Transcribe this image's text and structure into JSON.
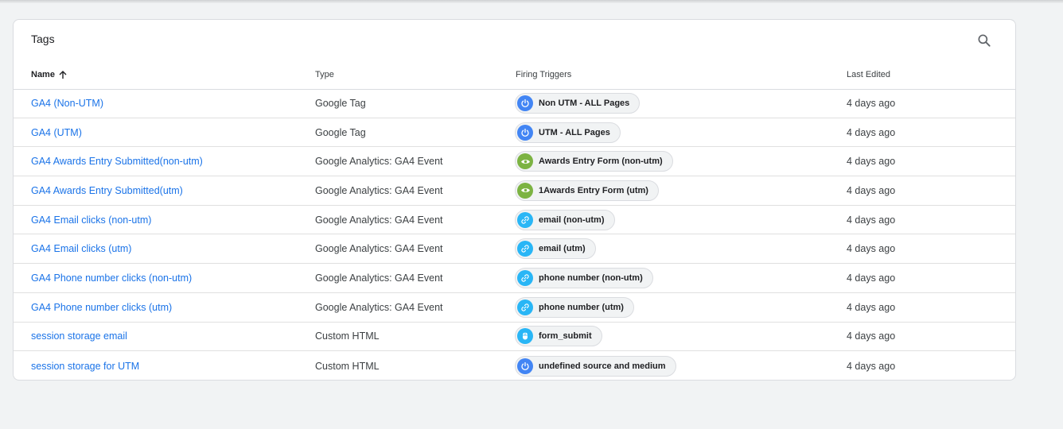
{
  "card": {
    "title": "Tags",
    "search_icon": "search-icon"
  },
  "columns": {
    "name": "Name",
    "type": "Type",
    "triggers": "Firing Triggers",
    "edited": "Last Edited"
  },
  "colors": {
    "link": "#1a73e8",
    "pageview_trigger": "#4285f4",
    "visibility_trigger": "#7cb342",
    "link_trigger": "#29b6f6",
    "custom_event_trigger": "#29b6f6"
  },
  "rows": [
    {
      "name": "GA4 (Non-UTM)",
      "type": "Google Tag",
      "trigger": "Non UTM - ALL Pages",
      "trigger_icon": "pageview-icon",
      "edited": "4 days ago"
    },
    {
      "name": "GA4 (UTM)",
      "type": "Google Tag",
      "trigger": "UTM - ALL Pages",
      "trigger_icon": "pageview-icon",
      "edited": "4 days ago"
    },
    {
      "name": "GA4 Awards Entry Submitted(non-utm)",
      "type": "Google Analytics: GA4 Event",
      "trigger": "Awards Entry Form (non-utm)",
      "trigger_icon": "visibility-icon",
      "edited": "4 days ago"
    },
    {
      "name": "GA4 Awards Entry Submitted(utm)",
      "type": "Google Analytics: GA4 Event",
      "trigger": "1Awards Entry Form (utm)",
      "trigger_icon": "visibility-icon",
      "edited": "4 days ago"
    },
    {
      "name": "GA4 Email clicks (non-utm)",
      "type": "Google Analytics: GA4 Event",
      "trigger": "email (non-utm)",
      "trigger_icon": "link-icon",
      "edited": "4 days ago"
    },
    {
      "name": "GA4 Email clicks (utm)",
      "type": "Google Analytics: GA4 Event",
      "trigger": "email (utm)",
      "trigger_icon": "link-icon",
      "edited": "4 days ago"
    },
    {
      "name": "GA4 Phone number clicks (non-utm)",
      "type": "Google Analytics: GA4 Event",
      "trigger": "phone number (non-utm)",
      "trigger_icon": "link-icon",
      "edited": "4 days ago"
    },
    {
      "name": "GA4 Phone number clicks (utm)",
      "type": "Google Analytics: GA4 Event",
      "trigger": "phone number (utm)",
      "trigger_icon": "link-icon",
      "edited": "4 days ago"
    },
    {
      "name": "session storage email",
      "type": "Custom HTML",
      "trigger": "form_submit",
      "trigger_icon": "custom-event-icon",
      "edited": "4 days ago"
    },
    {
      "name": "session storage for UTM",
      "type": "Custom HTML",
      "trigger": "undefined source and medium",
      "trigger_icon": "pageview-icon",
      "edited": "4 days ago"
    }
  ]
}
